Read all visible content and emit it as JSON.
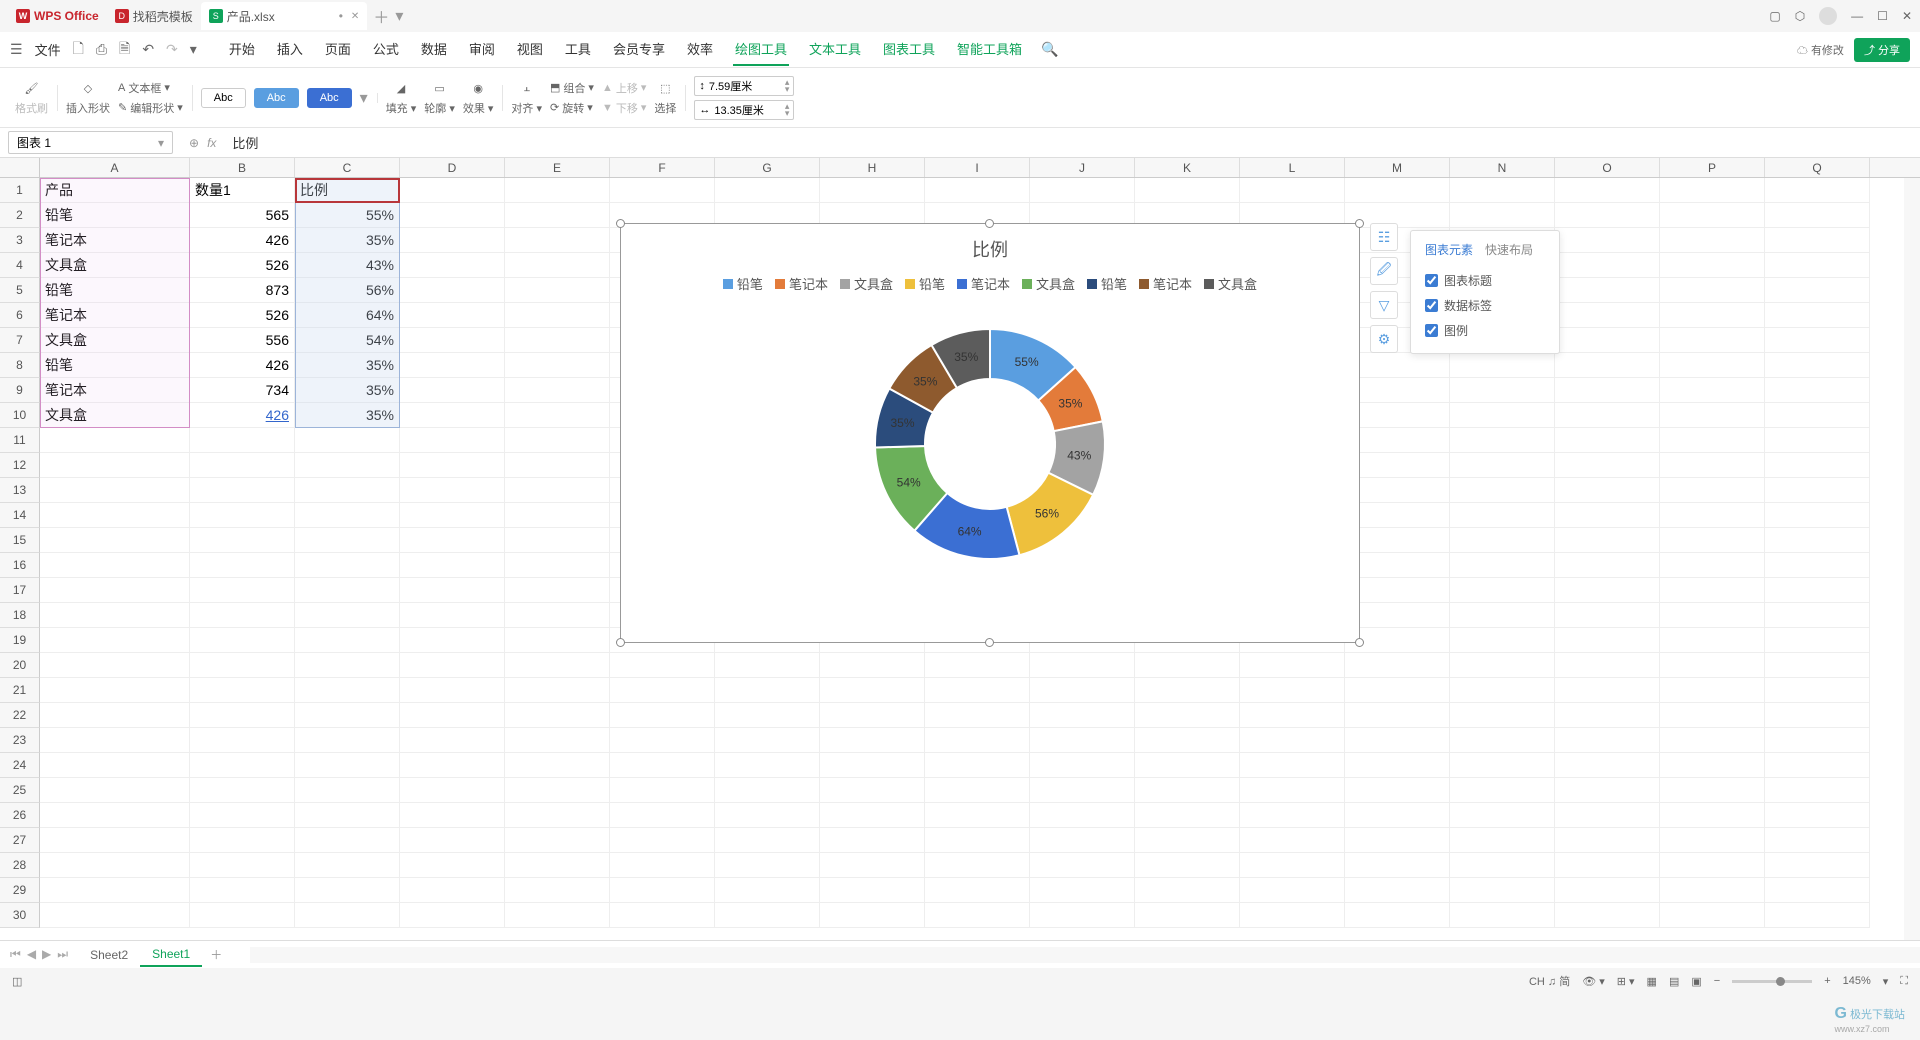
{
  "app_name": "WPS Office",
  "tabs": [
    {
      "label": "WPS Office",
      "type": "home"
    },
    {
      "label": "找稻壳模板",
      "type": "template"
    },
    {
      "label": "产品.xlsx",
      "type": "file",
      "modified": true
    }
  ],
  "menubar": {
    "file": "文件",
    "items": [
      "开始",
      "插入",
      "页面",
      "公式",
      "数据",
      "审阅",
      "视图",
      "工具",
      "会员专享",
      "效率",
      "绘图工具",
      "文本工具",
      "图表工具",
      "智能工具箱"
    ],
    "active": "绘图工具",
    "has_mod": "有修改",
    "share": "分享"
  },
  "ribbon": {
    "format_brush": "格式刷",
    "insert_shape": "插入形状",
    "edit_shape": "编辑形状",
    "text_box": "文本框",
    "abc": [
      "Abc",
      "Abc",
      "Abc"
    ],
    "fill": "填充",
    "outline": "轮廓",
    "effect": "效果",
    "align": "对齐",
    "group": "组合",
    "rotate": "旋转",
    "up": "上移",
    "down": "下移",
    "select": "选择",
    "height": "7.59厘米",
    "width": "13.35厘米"
  },
  "namebox": "图表 1",
  "formula": "比例",
  "columns": [
    "A",
    "B",
    "C",
    "D",
    "E",
    "F",
    "G",
    "H",
    "I",
    "J",
    "K",
    "L",
    "M",
    "N",
    "O",
    "P",
    "Q"
  ],
  "data_rows": [
    {
      "r": 1,
      "a": "产品",
      "b": "数量1",
      "c": "比例"
    },
    {
      "r": 2,
      "a": "铅笔",
      "b": "565",
      "c": "55%"
    },
    {
      "r": 3,
      "a": "笔记本",
      "b": "426",
      "c": "35%"
    },
    {
      "r": 4,
      "a": "文具盒",
      "b": "526",
      "c": "43%"
    },
    {
      "r": 5,
      "a": "铅笔",
      "b": "873",
      "c": "56%"
    },
    {
      "r": 6,
      "a": "笔记本",
      "b": "526",
      "c": "64%"
    },
    {
      "r": 7,
      "a": "文具盒",
      "b": "556",
      "c": "54%"
    },
    {
      "r": 8,
      "a": "铅笔",
      "b": "426",
      "c": "35%"
    },
    {
      "r": 9,
      "a": "笔记本",
      "b": "734",
      "c": "35%"
    },
    {
      "r": 10,
      "a": "文具盒",
      "b": "426",
      "c": "35%",
      "link": true
    }
  ],
  "empty_rows": [
    11,
    12,
    13,
    14,
    15,
    16,
    17,
    18,
    19,
    20,
    21,
    22,
    23,
    24,
    25,
    26,
    27,
    28,
    29,
    30
  ],
  "chart": {
    "title": "比例",
    "legend": [
      "铅笔",
      "笔记本",
      "文具盒",
      "铅笔",
      "笔记本",
      "文具盒",
      "铅笔",
      "笔记本",
      "文具盒"
    ],
    "colors": [
      "#5a9ee0",
      "#e37b3a",
      "#a3a3a3",
      "#eec03c",
      "#3b6fd3",
      "#6bb05a",
      "#2b4c7c",
      "#8e5a2e",
      "#5c5c5c"
    ]
  },
  "chart_data": {
    "type": "pie",
    "title": "比例",
    "series": [
      {
        "name": "铅笔",
        "value": 55,
        "label": "55%",
        "color": "#5a9ee0"
      },
      {
        "name": "笔记本",
        "value": 35,
        "label": "35%",
        "color": "#e37b3a"
      },
      {
        "name": "文具盒",
        "value": 43,
        "label": "43%",
        "color": "#a3a3a3"
      },
      {
        "name": "铅笔",
        "value": 56,
        "label": "56%",
        "color": "#eec03c"
      },
      {
        "name": "笔记本",
        "value": 64,
        "label": "64%",
        "color": "#3b6fd3"
      },
      {
        "name": "文具盒",
        "value": 54,
        "label": "54%",
        "color": "#6bb05a"
      },
      {
        "name": "铅笔",
        "value": 35,
        "label": "35%",
        "color": "#2b4c7c"
      },
      {
        "name": "笔记本",
        "value": 35,
        "label": "35%",
        "color": "#8e5a2e"
      },
      {
        "name": "文具盒",
        "value": 35,
        "label": "35%",
        "color": "#5c5c5c"
      }
    ]
  },
  "popup": {
    "tab1": "图表元素",
    "tab2": "快速布局",
    "opts": [
      "图表标题",
      "数据标签",
      "图例"
    ]
  },
  "sheets": {
    "names": [
      "Sheet2",
      "Sheet1"
    ],
    "active": "Sheet1"
  },
  "status": {
    "lang": "CH ♫ 简",
    "zoom": "145%"
  },
  "watermark": "极光下载站"
}
